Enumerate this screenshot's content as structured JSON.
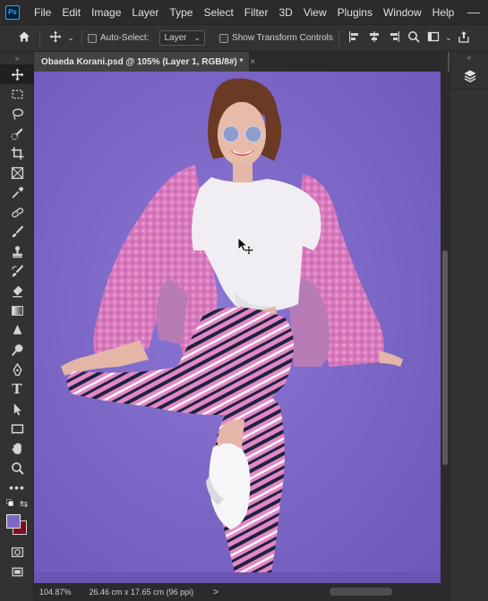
{
  "app": {
    "logo": "Ps"
  },
  "menu": [
    "File",
    "Edit",
    "Image",
    "Layer",
    "Type",
    "Select",
    "Filter",
    "3D",
    "View",
    "Plugins",
    "Window",
    "Help"
  ],
  "options": {
    "auto_select_label": "Auto-Select:",
    "auto_select_value": "Layer",
    "transform_label": "Show Transform Controls"
  },
  "document": {
    "tab_title": "Obaeda Korani.psd @ 105% (Layer 1, RGB/8#) *",
    "close_glyph": "×"
  },
  "status": {
    "zoom": "104.87%",
    "doc_size": "26.46 cm x 17.65 cm (96 ppi)",
    "arrow": ">"
  },
  "colors": {
    "foreground": "#7d68c4",
    "background": "#7a1020",
    "canvas_bg": "#7d68c4"
  }
}
